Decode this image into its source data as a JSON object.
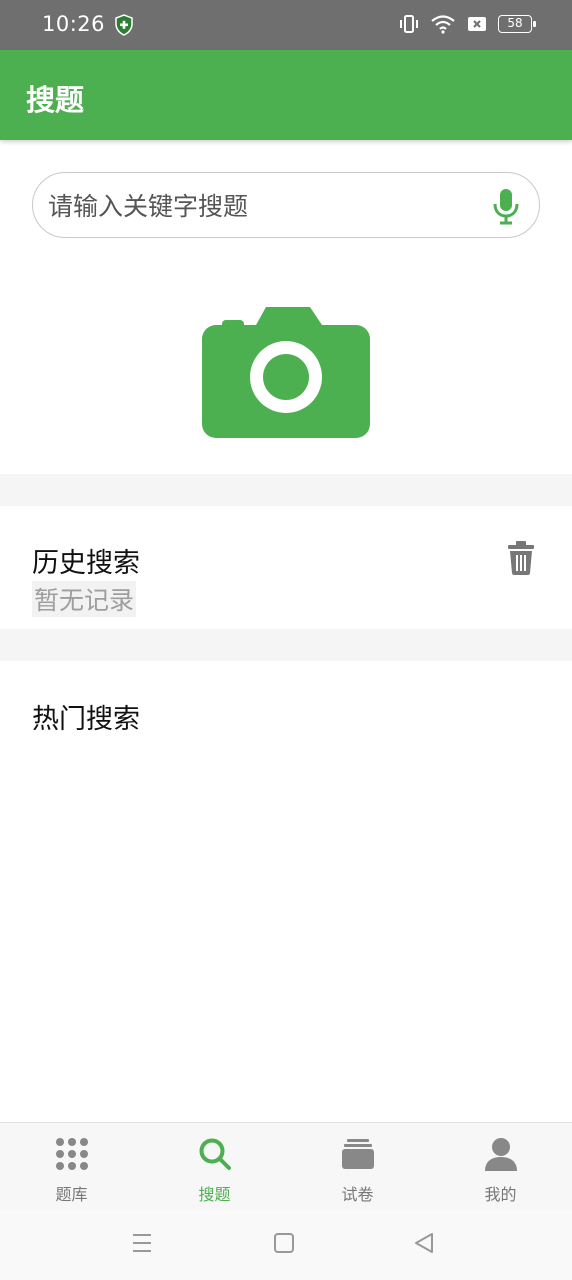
{
  "status_bar": {
    "time": "10:26",
    "battery": "58",
    "icons": [
      "shield-icon",
      "vibrate-icon",
      "wifi-icon",
      "no-sim-icon",
      "battery-icon"
    ]
  },
  "header": {
    "title": "搜题"
  },
  "search": {
    "placeholder": "请输入关键字搜题",
    "mic_icon": "mic-icon"
  },
  "camera": {
    "icon": "camera-icon"
  },
  "history": {
    "title": "历史搜索",
    "empty_text": "暂无记录",
    "delete_icon": "trash-icon"
  },
  "hot": {
    "title": "热门搜索"
  },
  "tabs": [
    {
      "label": "题库",
      "icon": "grid-icon",
      "active": false
    },
    {
      "label": "搜题",
      "icon": "search-icon",
      "active": true
    },
    {
      "label": "试卷",
      "icon": "papers-icon",
      "active": false
    },
    {
      "label": "我的",
      "icon": "person-icon",
      "active": false
    }
  ],
  "colors": {
    "primary": "#4caf50",
    "status_bar": "#6f6f6f",
    "inactive": "#777777"
  }
}
